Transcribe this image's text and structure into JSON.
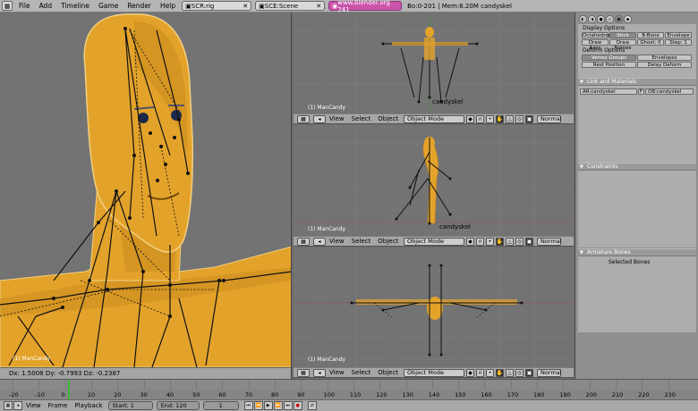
{
  "menu": [
    "File",
    "Add",
    "Timeline",
    "Game",
    "Render",
    "Help"
  ],
  "screen_field": "SCR:rig",
  "scene_field": "SCE:Scene",
  "url": "www.blender.org 241",
  "stats": "Bo:0-201 | Mem:6.20M candyskel",
  "left_view": {
    "object_label": "(1) ManCandy",
    "status": "Dx: 1.5008   Dy: -0.7993  Dz: -0.2387"
  },
  "top_view": {
    "object_label": "(1) ManCandy",
    "name": "candyskel"
  },
  "side_view": {
    "object_label": "(1) ManCandy",
    "name": "candyskel"
  },
  "front_view": {
    "object_label": "(1) ManCandy"
  },
  "view_header": {
    "view": "View",
    "select": "Select",
    "object": "Object",
    "mode": "Object Mode",
    "shading": "Normal"
  },
  "panel": {
    "display_options": "Display Options",
    "draw_buttons": [
      "Octahedron",
      "Stick",
      "B-Bone",
      "Envelope"
    ],
    "draw_axes": "Draw Axes",
    "draw_names": "Draw Names",
    "ghost": "Ghost: 0",
    "step": "Step: 1",
    "deform_options": "Deform Options",
    "vertex_groups": "Vertex Groups",
    "envelopes": "Envelopes",
    "rest_position": "Rest Position",
    "delay_deform": "Delay Deform",
    "links_title": "Link and Materials",
    "ar_name": "AR:candyskel",
    "f_label": "F",
    "ob_name": "OB:candyskel",
    "constraints_title": "Constraints",
    "armature_bones_title": "Armature Bones",
    "selected_bones": "Selected Bones"
  },
  "timeline": {
    "ticks": [
      "-20",
      "-10",
      "0",
      "10",
      "20",
      "30",
      "40",
      "50",
      "60",
      "70",
      "80",
      "90",
      "100",
      "110",
      "120",
      "130",
      "140",
      "150",
      "160",
      "170",
      "180",
      "190",
      "200",
      "210",
      "220",
      "230"
    ]
  },
  "bottom": {
    "view": "View",
    "frame": "Frame",
    "playback": "Playback",
    "start": "Start: 1",
    "end": "End: 120",
    "current": "1"
  },
  "colors": {
    "skin": "#e3a32b",
    "skin_shade": "#b97a14",
    "bone": "#1a1a1a",
    "viewport_bg": "#737373",
    "url_bg": "#cc55aa",
    "frame_marker": "#3bb83b"
  }
}
